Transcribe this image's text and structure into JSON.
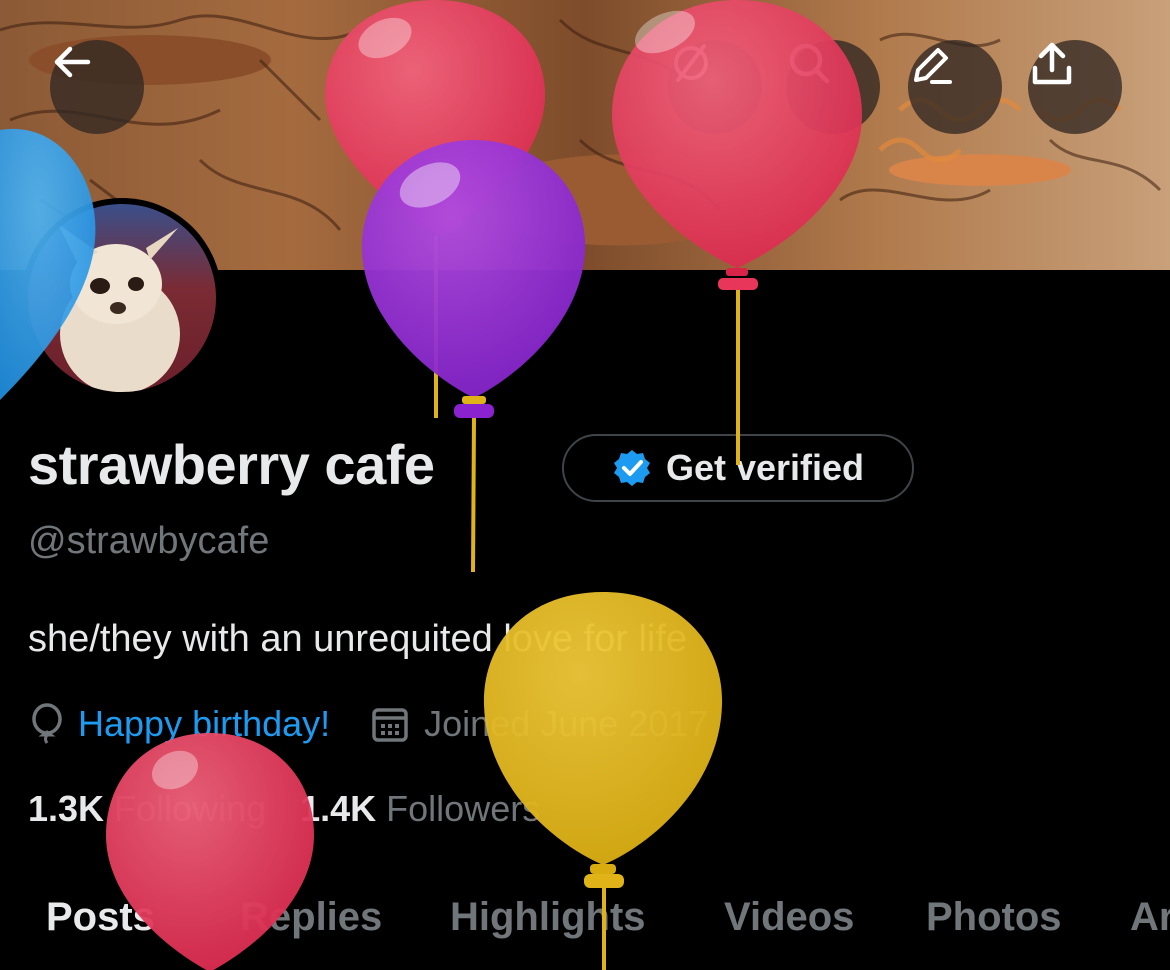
{
  "header": {
    "back_icon": "arrow-left-icon",
    "actions": [
      {
        "name": "grok-icon"
      },
      {
        "name": "search-icon"
      },
      {
        "name": "edit-icon"
      },
      {
        "name": "share-icon"
      }
    ]
  },
  "profile": {
    "display_name": "strawberry cafe",
    "get_verified_label": "Get verified",
    "handle": "@strawbycafe",
    "bio": "she/they with an unrequited love for life",
    "birthday_text": "Happy birthday!",
    "joined_text": "Joined June 2017",
    "following_count": "1.3K",
    "following_label": "Following",
    "followers_count": "1.4K",
    "followers_label": "Followers"
  },
  "tabs": [
    {
      "label": "Posts",
      "active": true
    },
    {
      "label": "Replies",
      "active": false
    },
    {
      "label": "Highlights",
      "active": false
    },
    {
      "label": "Videos",
      "active": false
    },
    {
      "label": "Photos",
      "active": false
    },
    {
      "label": "Ar",
      "active": false
    }
  ],
  "colors": {
    "background": "#000000",
    "text_primary": "#e7e9ea",
    "text_secondary": "#71767b",
    "accent": "#1d9bf0",
    "balloon_pink": "#e8365a",
    "balloon_purple": "#9b30d9",
    "balloon_yellow": "#e0b419",
    "balloon_blue": "#2e9ee8"
  }
}
